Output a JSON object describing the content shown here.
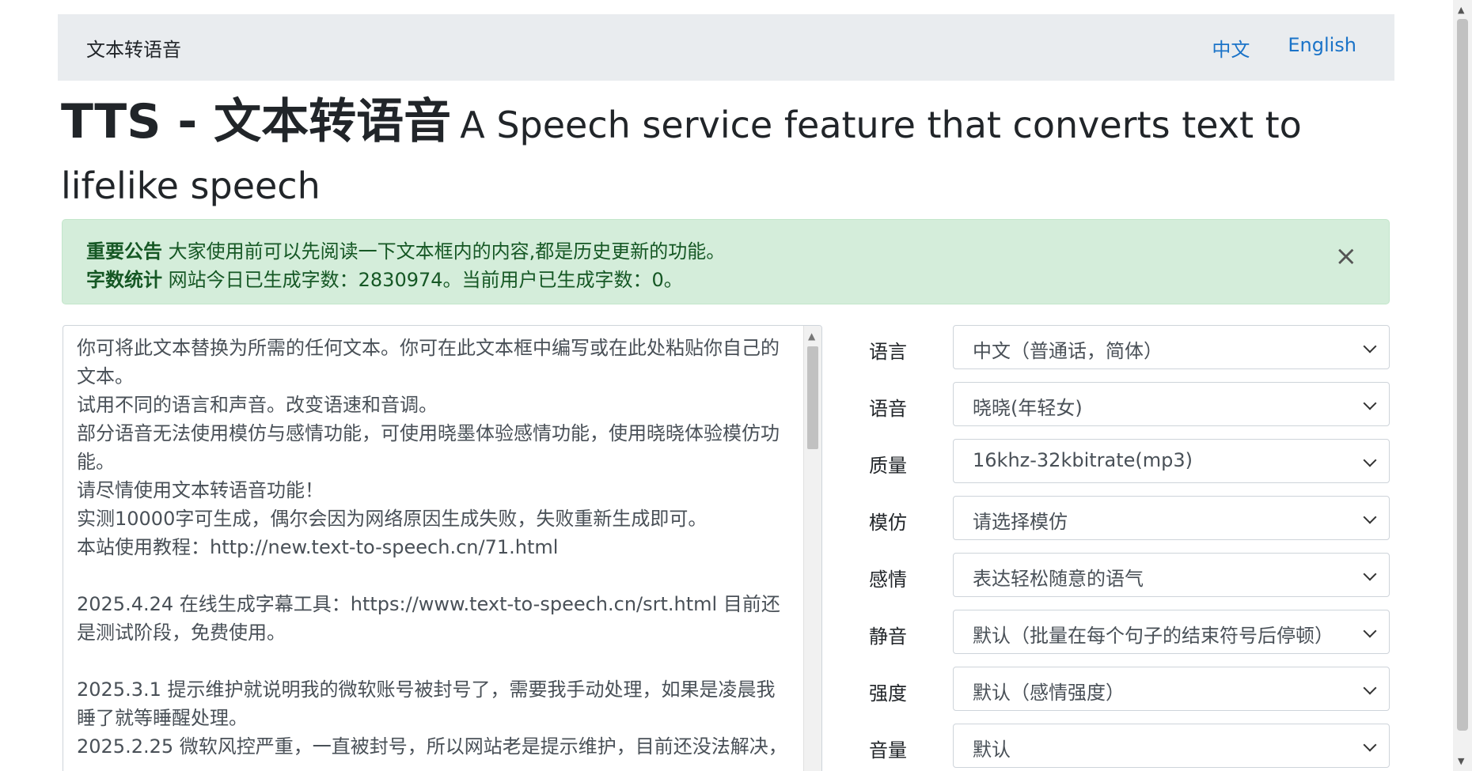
{
  "navbar": {
    "brand": "文本转语音",
    "links": [
      "中文",
      "English"
    ]
  },
  "headline": {
    "main": "TTS - 文本转语音",
    "sub": "A Speech service feature that converts text to lifelike speech"
  },
  "alert": {
    "line1_label": "重要公告",
    "line1_text": "大家使用前可以先阅读一下文本框内的内容,都是历史更新的功能。",
    "line2_label": "字数统计",
    "line2_text": "网站今日已生成字数：2830974。当前用户已生成字数：0。",
    "close": "×"
  },
  "textarea": {
    "value": "你可将此文本替换为所需的任何文本。你可在此文本框中编写或在此处粘贴你自己的文本。\n试用不同的语言和声音。改变语速和音调。\n部分语音无法使用模仿与感情功能，可使用晓墨体验感情功能，使用晓晓体验模仿功能。\n请尽情使用文本转语音功能！\n实测10000字可生成，偶尔会因为网络原因生成失败，失败重新生成即可。\n本站使用教程：http://new.text-to-speech.cn/71.html\n\n2025.4.24 在线生成字幕工具：https://www.text-to-speech.cn/srt.html 目前还是测试阶段，免费使用。\n\n2025.3.1 提示维护就说明我的微软账号被封号了，需要我手动处理，如果是凌晨我睡了就等睡醒处理。\n2025.2.25 微软风控严重，一直被封号，所以网站老是提示维护，目前还没法解决，"
  },
  "form": [
    {
      "label": "语言",
      "value": "中文（普通话，简体）"
    },
    {
      "label": "语音",
      "value": "晓晓(年轻女)"
    },
    {
      "label": "质量",
      "value": "16khz-32kbitrate(mp3)"
    },
    {
      "label": "模仿",
      "value": "请选择模仿"
    },
    {
      "label": "感情",
      "value": "表达轻松随意的语气"
    },
    {
      "label": "静音",
      "value": "默认（批量在每个句子的结束符号后停顿）"
    },
    {
      "label": "强度",
      "value": "默认（感情强度）"
    },
    {
      "label": "音量",
      "value": "默认"
    }
  ]
}
